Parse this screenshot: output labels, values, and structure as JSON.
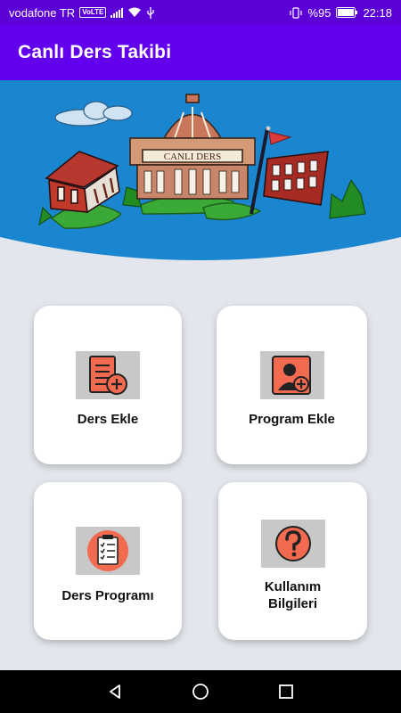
{
  "status_bar": {
    "carrier": "vodafone TR",
    "volte": "VoLTE",
    "battery": "%95",
    "time": "22:18"
  },
  "app_bar": {
    "title": "Canlı Ders Takibi"
  },
  "banner": {
    "sign_text": "CANLI DERS"
  },
  "menu": {
    "ders_ekle": "Ders Ekle",
    "program_ekle": "Program Ekle",
    "ders_programi": "Ders Programı",
    "kullanim_line1": "Kullanım",
    "kullanim_line2": "Bilgileri"
  },
  "colors": {
    "status_bar": "#5b00d6",
    "app_bar": "#6200ee",
    "banner_blue": "#1a86d0",
    "accent_coral": "#f26a4f",
    "background": "#e3e6ec"
  }
}
